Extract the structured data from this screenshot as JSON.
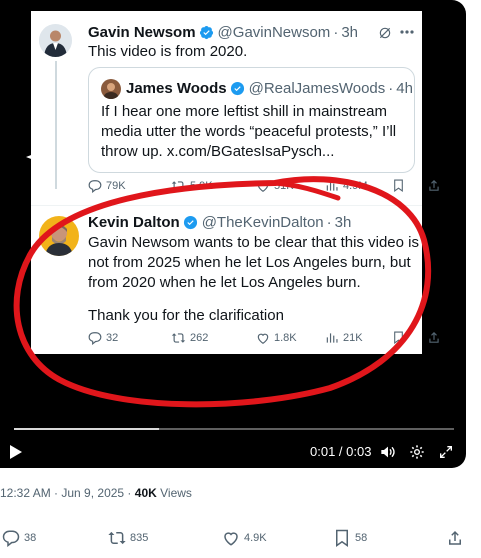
{
  "video": {
    "tweet": {
      "author_name": "Gavin Newsom",
      "author_handle": "@GavinNewsom",
      "time": "3h",
      "text": "This video is from 2020.",
      "quote": {
        "author_name": "James Woods",
        "author_handle": "@RealJamesWoods",
        "time": "4h",
        "text_lines": [
          "If I hear one more leftist shill in mainstream",
          "media utter the words “peaceful protests,” I’ll",
          "throw up.  x.com/BGatesIsaPysch..."
        ]
      },
      "actions": {
        "replies": "79K",
        "reposts": "5.9K",
        "likes": "51K",
        "views": "4.9M"
      }
    },
    "reply": {
      "author_name": "Kevin Dalton",
      "author_handle": "@TheKevinDalton",
      "time": "3h",
      "text_lines": [
        "Gavin Newsom wants to be clear that this video is",
        "not from 2025 when he let Los Angeles burn, but",
        "from 2020 when he let Los Angeles burn."
      ],
      "text_line2": "Thank you for the clarification",
      "actions": {
        "replies": "32",
        "reposts": "262",
        "likes": "1.8K",
        "views": "21K"
      }
    },
    "player": {
      "time": "0:01 / 0:03",
      "progress": 0.33
    }
  },
  "post_meta": {
    "time": "12:32 AM · Jun 9, 2025 ·",
    "views_count": "40K",
    "views_label": "Views"
  },
  "post_stats": {
    "replies": "38",
    "reposts": "835",
    "likes": "4.9K",
    "bookmarks": "58"
  },
  "colors": {
    "accent": "#1d9bf0",
    "annotation": "#e0161b",
    "muted": "#536471"
  },
  "icons": [
    "verified-icon",
    "grok-icon",
    "more-icon",
    "reply-icon",
    "repost-icon",
    "like-icon",
    "views-icon",
    "bookmark-icon",
    "share-icon",
    "play-icon",
    "volume-icon",
    "settings-icon",
    "fullscreen-icon"
  ]
}
